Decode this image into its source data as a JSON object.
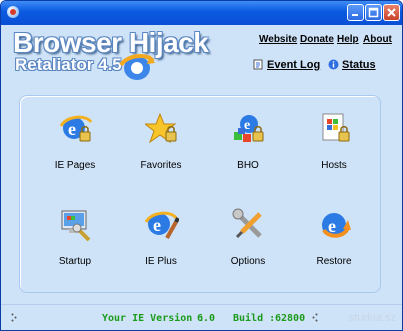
{
  "window": {
    "controls": {
      "minimize": "minimize-icon",
      "maximize": "maximize-icon",
      "close": "close-icon"
    },
    "accent": "#0a5ae0",
    "background": "#cfe3f8"
  },
  "header": {
    "logo_title": "Browser Hijack",
    "logo_subtitle": "Retaliator 4.5",
    "links": [
      "Website",
      "Donate",
      "Help",
      "About"
    ],
    "event_log": "Event Log",
    "status": "Status"
  },
  "tiles": [
    {
      "label": "IE Pages",
      "icon": "ie-pages-icon"
    },
    {
      "label": "Favorites",
      "icon": "favorites-star-icon"
    },
    {
      "label": "BHO",
      "icon": "bho-icon"
    },
    {
      "label": "Hosts",
      "icon": "hosts-icon"
    },
    {
      "label": "Startup",
      "icon": "startup-icon"
    },
    {
      "label": "IE Plus",
      "icon": "ie-plus-icon"
    },
    {
      "label": "Options",
      "icon": "options-tools-icon"
    },
    {
      "label": "Restore",
      "icon": "restore-icon"
    }
  ],
  "statusbar": {
    "ie_version_label": "Your IE Version :",
    "ie_version": "6.0",
    "build_label": "Build :",
    "build": "62800",
    "watermark": "studna.sz"
  },
  "colors": {
    "status_text": "#1b9b1b",
    "title_bar": "#0a5ae0",
    "panel_border": "#a9c8ee"
  }
}
